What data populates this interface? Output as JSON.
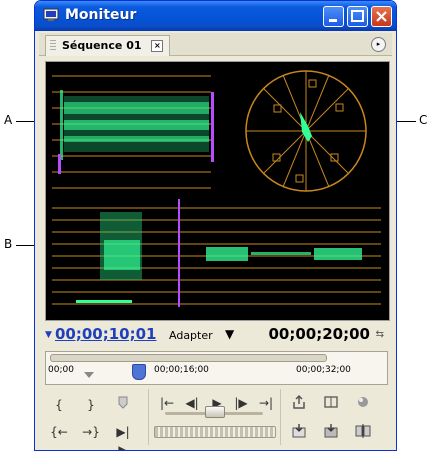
{
  "callouts": {
    "a": "A",
    "b": "B",
    "c": "C"
  },
  "window": {
    "title": "Moniteur"
  },
  "tab": {
    "label": "Séquence 01",
    "close_glyph": "×",
    "menu_glyph": "▸"
  },
  "titlebar_buttons": {
    "minimize": "minimize-button",
    "maximize": "maximize-button",
    "close": "close-button"
  },
  "timecode": {
    "current": "00;00;10;01",
    "fit_label": "Adapter",
    "fit_arrow": "▼",
    "duration": "00;00;20;00",
    "duration_icon": "⇆",
    "mark_icon": "▼"
  },
  "ruler": {
    "labels": [
      "00;00",
      "00;00;16;00",
      "00;00;32;00"
    ]
  },
  "controls": {
    "set_in": "{",
    "set_out": "}",
    "marker": "marker-icon",
    "go_to_in": "|←",
    "step_back": "◀|",
    "play": "▶",
    "step_forward": "|▶",
    "go_to_out": "→|",
    "go_in": "{←",
    "go_out": "→}",
    "play_in_out": "▶|▶",
    "lift": "lift-icon",
    "extract": "extract-icon",
    "output": "output-icon",
    "insert": "insert-icon",
    "overlay": "overlay-icon",
    "trim": "trim-icon"
  },
  "colors": {
    "accent_blue": "#1f3fbe",
    "scope_green": "#33ff99",
    "scope_orange": "#c8871e",
    "scope_magenta": "#b84cff",
    "titlebar": "#0553d6"
  }
}
